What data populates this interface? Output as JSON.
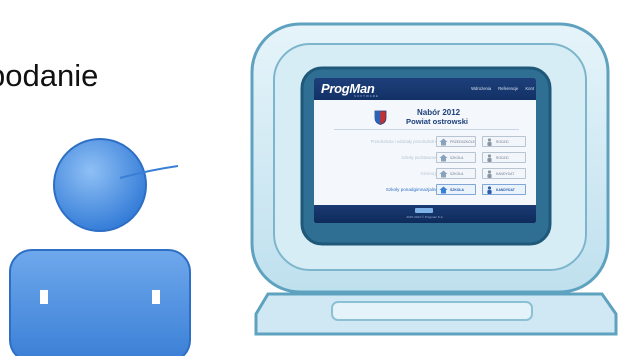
{
  "slide": {
    "text": "podanie"
  },
  "screen": {
    "logo": "ProgMan",
    "logo_sub": "SOFTWARE",
    "nav": [
      "Wdrożenia",
      "Referencje",
      "Kont"
    ],
    "title_line1": "Nabór 2012",
    "title_line2": "Powiat ostrowski",
    "rows": [
      {
        "label": "Przedszkola i oddziały przedszkolne",
        "btn1": "PRZEDSZKOLE",
        "btn2": "RODZIC",
        "active": false
      },
      {
        "label": "Szkoły podstawowe",
        "btn1": "SZKOŁA",
        "btn2": "RODZIC",
        "active": false
      },
      {
        "label": "Gimnazja",
        "btn1": "SZKOŁA",
        "btn2": "KANDYDAT",
        "active": false
      },
      {
        "label": "Szkoły ponadgimnazjalne",
        "btn1": "SZKOŁA",
        "btn2": "KANDYDAT",
        "active": true
      }
    ],
    "footer_copy": "2007-2012 © Progman S.A."
  },
  "colors": {
    "header_blue": "#1d3f7a",
    "active_blue": "#2e6fc4",
    "monitor_light": "#dbeef7",
    "person_blue": "#4d8ee0"
  }
}
